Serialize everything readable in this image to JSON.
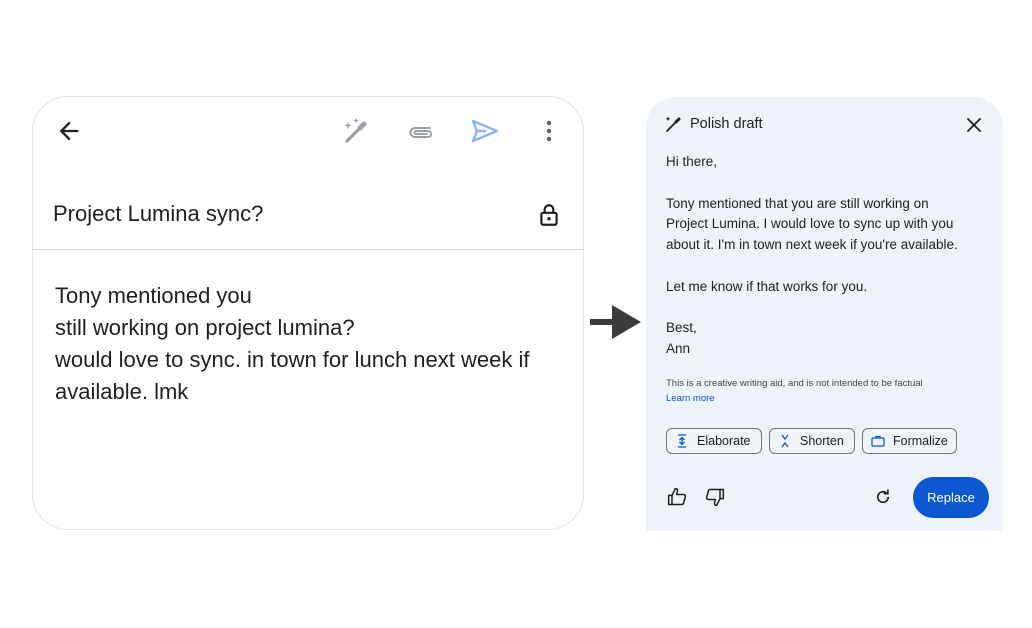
{
  "compose": {
    "subject": "Project Lumina sync?",
    "body_lines": [
      "Tony mentioned you",
      "still working on project lumina?",
      "would love to sync. in town for lunch next week if",
      "available. lmk"
    ],
    "icons": {
      "back": "back-arrow-icon",
      "help_me_write": "sparkle-pen-icon",
      "attach": "paperclip-icon",
      "send": "send-icon",
      "more": "more-vert-icon",
      "confidential": "lock-icon"
    }
  },
  "panel": {
    "title": "Polish draft",
    "draft_lines": {
      "greeting": "Hi there,",
      "p1_l1": "Tony mentioned that you are still working on",
      "p1_l2": "Project Lumina. I would love to sync up with you",
      "p1_l3": "about it. I'm in town next week if you're available.",
      "p2": "Let me know if that works for you.",
      "signoff": "Best,",
      "name": "Ann"
    },
    "disclaimer": "This is a creative writing aid, and is not intended to be factual",
    "learn_more": "Learn more",
    "chips": {
      "elaborate": "Elaborate",
      "shorten": "Shorten",
      "formalize": "Formalize"
    },
    "replace_label": "Replace",
    "colors": {
      "panel_bg": "#eef2f9",
      "accent": "#0b57d0",
      "send_icon": "#8ab4f8"
    }
  }
}
